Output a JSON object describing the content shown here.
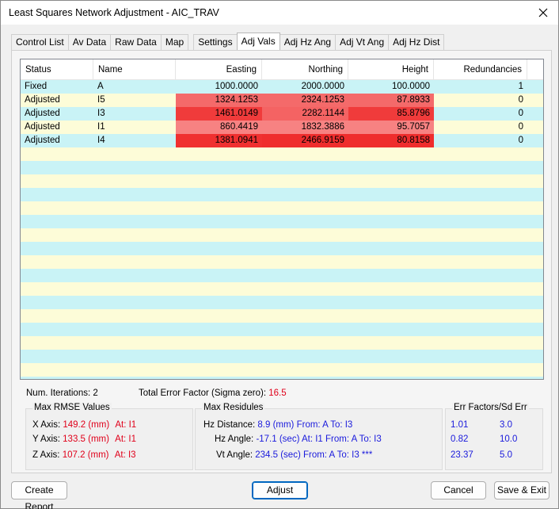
{
  "window": {
    "title": "Least Squares Network Adjustment - AIC_TRAV"
  },
  "tabs": [
    {
      "label": "Control List"
    },
    {
      "label": "Av Data"
    },
    {
      "label": "Raw Data"
    },
    {
      "label": "Map"
    },
    {
      "label": "Settings"
    },
    {
      "label": "Adj Vals"
    },
    {
      "label": "Adj Hz Ang"
    },
    {
      "label": "Adj Vt Ang"
    },
    {
      "label": "Adj Hz Dist"
    }
  ],
  "active_tab": "Adj Vals",
  "table": {
    "headers": {
      "status": "Status",
      "name": "Name",
      "easting": "Easting",
      "northing": "Northing",
      "height": "Height",
      "redundancies": "Redundancies"
    },
    "rows": [
      {
        "status": "Fixed",
        "name": "A",
        "easting": "1000.0000",
        "northing": "2000.0000",
        "height": "100.0000",
        "redundancies": "1",
        "easting_bg": "",
        "northing_bg": "",
        "height_bg": ""
      },
      {
        "status": "Adjusted",
        "name": "I5",
        "easting": "1324.1253",
        "northing": "2324.1253",
        "height": "87.8933",
        "redundancies": "0",
        "easting_bg": "#f46a6a",
        "northing_bg": "#f46a6a",
        "height_bg": "#f46a6a"
      },
      {
        "status": "Adjusted",
        "name": "I3",
        "easting": "1461.0149",
        "northing": "2282.1144",
        "height": "85.8796",
        "redundancies": "0",
        "easting_bg": "#f03b3b",
        "northing_bg": "#f46363",
        "height_bg": "#f03b3b"
      },
      {
        "status": "Adjusted",
        "name": "I1",
        "easting": "860.4419",
        "northing": "1832.3886",
        "height": "95.7057",
        "redundancies": "0",
        "easting_bg": "#f78282",
        "northing_bg": "#f78282",
        "height_bg": "#f78282"
      },
      {
        "status": "Adjusted",
        "name": "I4",
        "easting": "1381.0941",
        "northing": "2466.9159",
        "height": "80.8158",
        "redundancies": "0",
        "easting_bg": "#f03030",
        "northing_bg": "#ef2d2d",
        "height_bg": "#ef2d2d"
      }
    ]
  },
  "stats": {
    "iterations_label": "Num. Iterations: 2",
    "total_error_label": "Total Error Factor (Sigma zero):",
    "total_error_value": "16.5"
  },
  "rmse": {
    "title": "Max RMSE Values",
    "x_label": "X Axis:",
    "x_value": "149.2 (mm)",
    "x_at": "At: I1",
    "y_label": "Y Axis:",
    "y_value": "133.5 (mm)",
    "y_at": "At: I1",
    "z_label": "Z Axis:",
    "z_value": "107.2 (mm)",
    "z_at": "At: I3"
  },
  "residuals": {
    "title": "Max Residules",
    "hz_dist_label": "Hz Distance:",
    "hz_dist_value": "8.9 (mm)  From: A To: I3",
    "hz_ang_label": "Hz Angle:",
    "hz_ang_value": "-17.1 (sec) At: I1 From: A To: I3",
    "vt_ang_label": "Vt Angle:",
    "vt_ang_value": "234.5 (sec) From: A To: I3   ***"
  },
  "err_factors": {
    "title": "Err Factors/Sd Err",
    "rows": [
      {
        "factor": "1.01",
        "sd": "3.0"
      },
      {
        "factor": "0.82",
        "sd": "10.0"
      },
      {
        "factor": "23.37",
        "sd": "5.0"
      }
    ]
  },
  "buttons": {
    "create_report": "Create Report",
    "adjust": "Adjust",
    "cancel": "Cancel",
    "save_exit": "Save & Exit"
  },
  "colors": {
    "row_cyan": "#c9f3f6",
    "row_yellow": "#fdfcd8",
    "error_red": "#e0001a",
    "value_blue": "#1a1adc",
    "accent": "#0067c0"
  }
}
